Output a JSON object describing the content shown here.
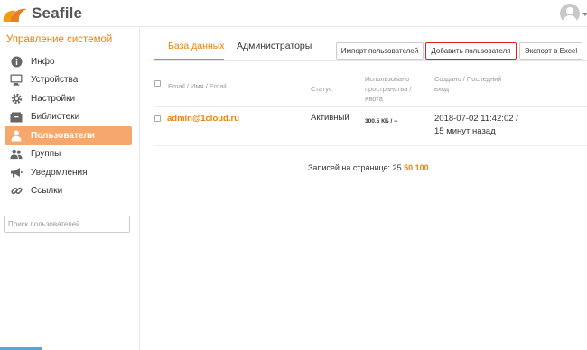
{
  "header": {
    "logo_text": "Seafile",
    "logo_icon": "seafile-logo-icon",
    "avatar_icon": "user-avatar-icon"
  },
  "sidebar": {
    "title": "Управление системой",
    "items": [
      {
        "label": "Инфо",
        "icon": "info-icon"
      },
      {
        "label": "Устройства",
        "icon": "monitor-icon"
      },
      {
        "label": "Настройки",
        "icon": "gear-icon"
      },
      {
        "label": "Библиотеки",
        "icon": "library-icon"
      },
      {
        "label": "Пользователи",
        "icon": "user-icon",
        "active": true
      },
      {
        "label": "Группы",
        "icon": "group-icon"
      },
      {
        "label": "Уведомления",
        "icon": "megaphone-icon"
      },
      {
        "label": "Ссылки",
        "icon": "link-icon"
      }
    ],
    "search_placeholder": "Поиск пользователей..."
  },
  "tabs": [
    {
      "label": "База данных",
      "active": true
    },
    {
      "label": "Администраторы",
      "active": false
    }
  ],
  "toolbar": {
    "import_label": "Импорт пользователей",
    "add_label": "Добавить пользователя",
    "export_label": "Экспорт в Excel"
  },
  "table": {
    "columns": {
      "email": "Email / Имя / Email",
      "status": "Статус",
      "space_line1": "Использовано",
      "space_line2": "пространства /",
      "space_line3": "Квота",
      "created_line1": "Создано / Последний",
      "created_line2": "вход"
    },
    "rows": [
      {
        "email": "admin@1cloud.ru",
        "status": "Активный",
        "space": "300.5 КБ / --",
        "created": "2018-07-02 11:42:02 /",
        "last_login": "15 минут назад"
      }
    ]
  },
  "pagination": {
    "label": "Записей на странице:",
    "options": [
      "25",
      "50",
      "100"
    ],
    "selected": "25"
  },
  "colors": {
    "accent": "#eb8205",
    "active_item_bg": "#f6a86c",
    "highlight_border": "#d9241a"
  }
}
